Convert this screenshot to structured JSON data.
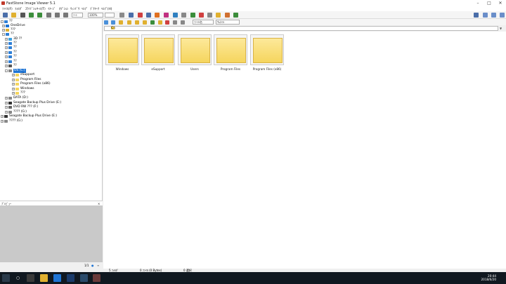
{
  "window": {
    "title": "FastStone Image Viewer 5.1"
  },
  "menu": [
    "ﾌｧｲﾙ(F)",
    "ﾌｫﾙﾀﾞ",
    "ｽﾗｲﾄﾞｼｮｰ",
    "ﾂｰﾙ(T)",
    "ｲﾒｰｼﾞ",
    "ｵﾌﾟｼｮﾝ",
    "ｳｨﾝﾄﾞｳ",
    "ﾍﾙﾌﾟ",
    "ﾌﾞｸﾏｰｸ",
    "ﾍﾙﾌﾟ(H)"
  ],
  "toolbar": {
    "zoom": "100%",
    "sort_label": "ｿｰﾄ",
    "filter_label": "ﾌｨﾙﾀｰ"
  },
  "nav": {
    "sort_select": "ﾌｧｲﾙ名",
    "filter_select": "ｻﾑﾈｲﾙ"
  },
  "address": {
    "path": "C:\\"
  },
  "tree": [
    {
      "label": "??",
      "level": 0,
      "icon": "desktop-icon",
      "exp": "-"
    },
    {
      "label": "OneDrive",
      "level": 1,
      "icon": "cloud-icon",
      "exp": "+"
    },
    {
      "label": "???",
      "level": 1,
      "icon": "user-icon",
      "exp": "+"
    },
    {
      "label": "??",
      "level": 1,
      "icon": "computer-icon",
      "exp": "-"
    },
    {
      "label": "3D ??",
      "level": 2,
      "icon": "folder-icon",
      "exp": "+"
    },
    {
      "label": "??",
      "level": 2,
      "icon": "folder-icon",
      "exp": "+"
    },
    {
      "label": "??",
      "level": 2,
      "icon": "folder-icon",
      "exp": "+"
    },
    {
      "label": "??",
      "level": 2,
      "icon": "folder-icon",
      "exp": "+"
    },
    {
      "label": "??",
      "level": 2,
      "icon": "folder-icon",
      "exp": "+"
    },
    {
      "label": "??",
      "level": 2,
      "icon": "folder-icon",
      "exp": "+"
    },
    {
      "label": "??",
      "level": 2,
      "icon": "folder-icon",
      "exp": "+"
    },
    {
      "label": "OS (C:)",
      "level": 2,
      "icon": "drive-icon",
      "exp": "-",
      "selected": true
    },
    {
      "label": "eSupport",
      "level": 3,
      "icon": "folder-icon",
      "exp": "+"
    },
    {
      "label": "Program Files",
      "level": 3,
      "icon": "folder-icon",
      "exp": "+"
    },
    {
      "label": "Program Files (x86)",
      "level": 3,
      "icon": "folder-icon",
      "exp": "+"
    },
    {
      "label": "Windows",
      "level": 3,
      "icon": "folder-icon",
      "exp": "+"
    },
    {
      "label": "???",
      "level": 3,
      "icon": "folder-icon",
      "exp": "+"
    },
    {
      "label": "DATA (D:)",
      "level": 2,
      "icon": "drive-icon",
      "exp": "+"
    },
    {
      "label": "Seagate Backup Plus Drive (E:)",
      "level": 2,
      "icon": "drive-icon",
      "exp": "+"
    },
    {
      "label": "DVD RW ??? (F:)",
      "level": 2,
      "icon": "dvd-icon",
      "exp": "+"
    },
    {
      "label": "???? (G:)",
      "level": 2,
      "icon": "drive-icon",
      "exp": "+"
    },
    {
      "label": "Seagate Backup Plus Drive (E:)",
      "level": 1,
      "icon": "drive-icon",
      "exp": "+"
    },
    {
      "label": "???? (G:)",
      "level": 1,
      "icon": "drive-icon",
      "exp": "+"
    }
  ],
  "preview_header": "ﾌﾟﾚﾋﾞｭｰ",
  "left_status": {
    "page": "1/1"
  },
  "thumbnails": [
    "Windows",
    "eSupport",
    "Users",
    "Program Files",
    "Program Files (x86)"
  ],
  "status": {
    "folders": "5 ﾌｫﾙﾀﾞ",
    "files": "0 ﾌｧｲﾙ (0 Bytes)",
    "selected": "0 選択"
  },
  "taskbar": {
    "time": "20:44",
    "date": "2018/6/20"
  }
}
